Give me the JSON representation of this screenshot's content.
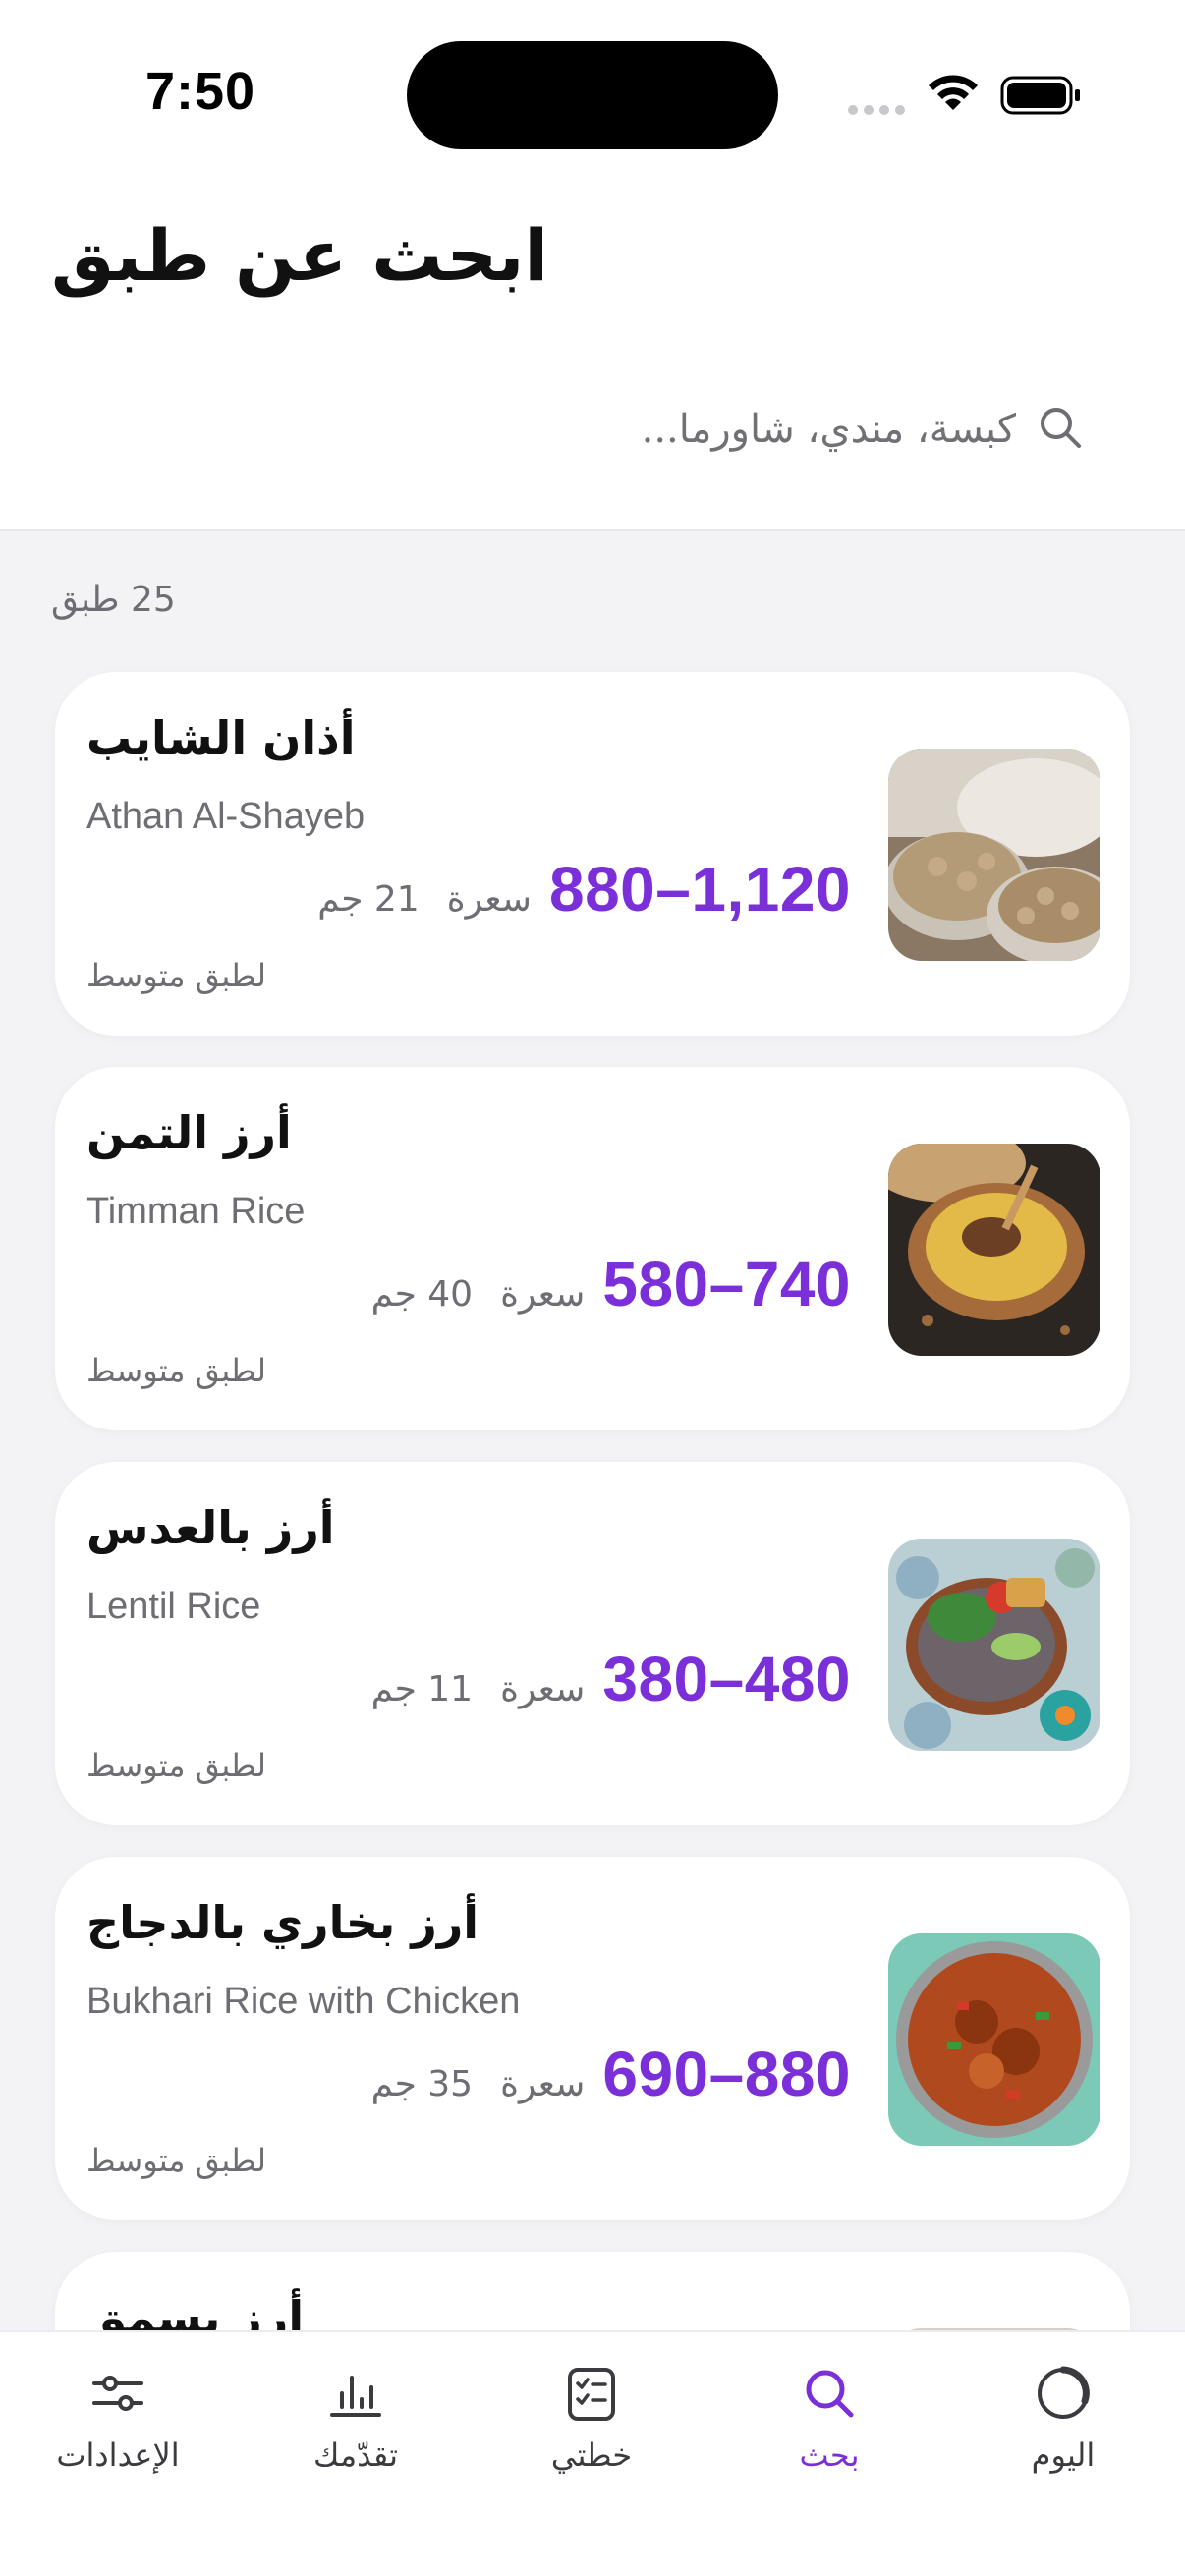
{
  "status_bar": {
    "time": "7:50"
  },
  "header": {
    "title": "ابحث عن طبق",
    "search_placeholder": "كبسة، مندي، شاورما..."
  },
  "results": {
    "count_label": "25 طبق",
    "items": [
      {
        "name_ar": "أذان الشايب",
        "name_en": "Athan Al-Shayeb",
        "calories": "880–1,120",
        "cal_unit": "سعرة",
        "weight": "21 جم",
        "portion": "لطبق متوسط"
      },
      {
        "name_ar": "أرز التمن",
        "name_en": "Timman Rice",
        "calories": "580–740",
        "cal_unit": "سعرة",
        "weight": "40 جم",
        "portion": "لطبق متوسط"
      },
      {
        "name_ar": "أرز بالعدس",
        "name_en": "Lentil Rice",
        "calories": "380–480",
        "cal_unit": "سعرة",
        "weight": "11 جم",
        "portion": "لطبق متوسط"
      },
      {
        "name_ar": "أرز بخاري بالدجاج",
        "name_en": "Bukhari Rice with Chicken",
        "calories": "690–880",
        "cal_unit": "سعرة",
        "weight": "35 جم",
        "portion": "لطبق متوسط"
      },
      {
        "name_ar": "أرز بسمق"
      }
    ]
  },
  "tabbar": {
    "active": "search",
    "tabs": [
      {
        "id": "today",
        "label": "اليوم",
        "icon": "progress-ring-icon"
      },
      {
        "id": "search",
        "label": "بحث",
        "icon": "search-icon"
      },
      {
        "id": "plans",
        "label": "خطتي",
        "icon": "checklist-icon"
      },
      {
        "id": "progress",
        "label": "تقدّمك",
        "icon": "bar-chart-icon"
      },
      {
        "id": "settings",
        "label": "الإعدادات",
        "icon": "sliders-icon"
      }
    ]
  },
  "colors": {
    "accent": "#7a2fd8",
    "text": "#111111",
    "muted": "#6d6d73",
    "background": "#f3f3f6"
  }
}
